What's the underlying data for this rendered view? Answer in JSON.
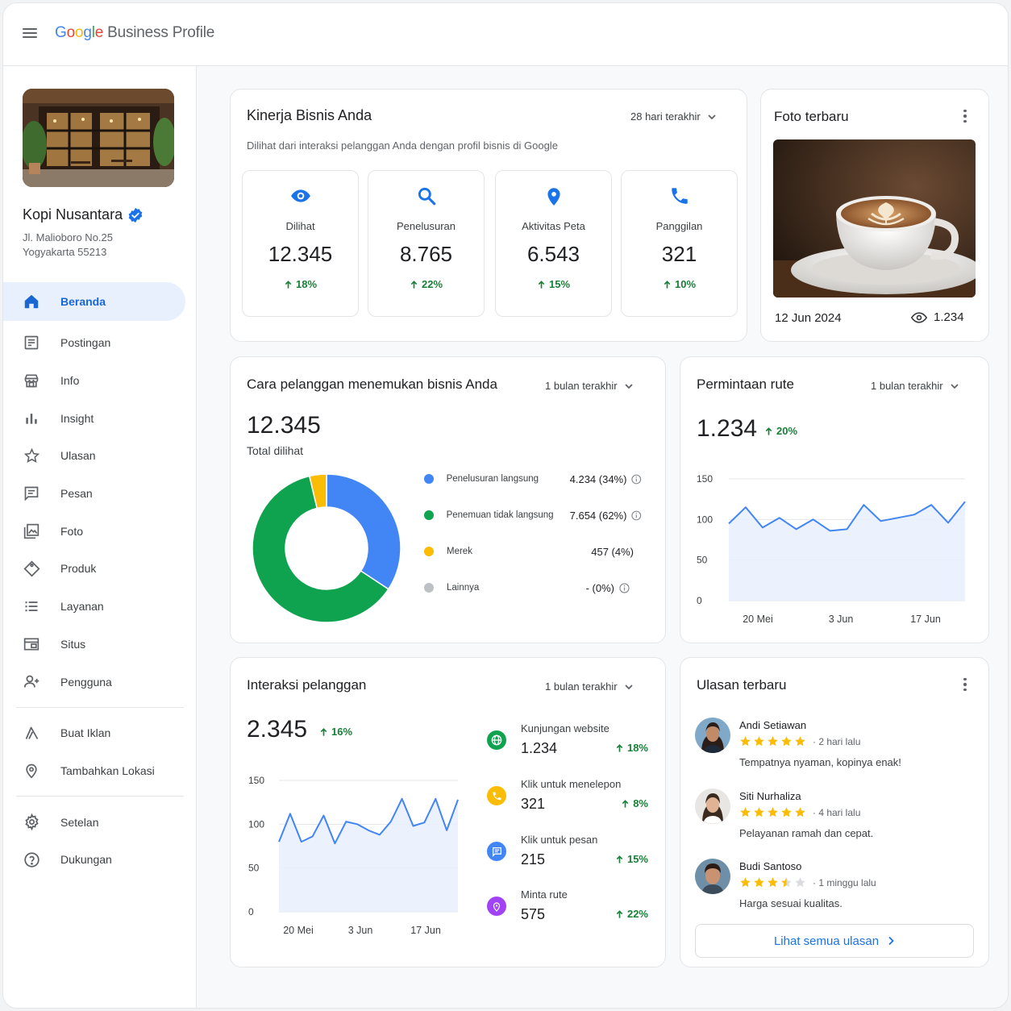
{
  "app": {
    "logo_parts": [
      "G",
      "o",
      "o",
      "g",
      "l",
      "e"
    ],
    "product": "Business Profile"
  },
  "business": {
    "name": "Kopi Nusantara",
    "address_line1": "Jl. Malioboro No.25",
    "address_line2": "Yogyakarta 55213"
  },
  "nav": {
    "items": [
      {
        "label": "Beranda",
        "icon": "home-icon"
      },
      {
        "label": "Postingan",
        "icon": "posts-icon"
      },
      {
        "label": "Info",
        "icon": "store-icon"
      },
      {
        "label": "Insight",
        "icon": "bar-chart-icon"
      },
      {
        "label": "Ulasan",
        "icon": "star-icon"
      },
      {
        "label": "Pesan",
        "icon": "message-icon"
      },
      {
        "label": "Foto",
        "icon": "photo-icon"
      },
      {
        "label": "Produk",
        "icon": "tag-icon"
      },
      {
        "label": "Layanan",
        "icon": "list-icon"
      },
      {
        "label": "Situs",
        "icon": "website-icon"
      },
      {
        "label": "Pengguna",
        "icon": "add-user-icon"
      }
    ],
    "extra": [
      {
        "label": "Buat Iklan",
        "icon": "ads-icon"
      },
      {
        "label": "Tambahkan Lokasi",
        "icon": "location-icon"
      }
    ],
    "bottom": [
      {
        "label": "Setelan",
        "icon": "gear-icon"
      },
      {
        "label": "Dukungan",
        "icon": "help-icon"
      }
    ]
  },
  "performance": {
    "title": "Kinerja Bisnis Anda",
    "range": "28 hari terakhir",
    "subtitle": "Dilihat dari interaksi pelanggan Anda dengan profil bisnis di Google",
    "metrics": [
      {
        "label": "Dilihat",
        "value": "12.345",
        "delta": "18%",
        "icon": "eye-icon"
      },
      {
        "label": "Penelusuran",
        "value": "8.765",
        "delta": "22%",
        "icon": "search-icon"
      },
      {
        "label": "Aktivitas Peta",
        "value": "6.543",
        "delta": "15%",
        "icon": "map-pin-icon"
      },
      {
        "label": "Panggilan",
        "value": "321",
        "delta": "10%",
        "icon": "phone-icon"
      }
    ]
  },
  "photo": {
    "title": "Foto terbaru",
    "date": "12 Jun 2024",
    "views": "1.234"
  },
  "discovery": {
    "title": "Cara pelanggan menemukan bisnis Anda",
    "range": "1 bulan terakhir",
    "total": "12.345",
    "total_label": "Total dilihat",
    "legend": [
      {
        "name": "Penelusuran langsung",
        "value": "4.234 (34%)",
        "color": "#4285f4",
        "info": true
      },
      {
        "name": "Penemuan tidak langsung",
        "value": "7.654 (62%)",
        "color": "#0fa34f",
        "info": true
      },
      {
        "name": "Merek",
        "value": "457 (4%)",
        "color": "#fbbc05",
        "info": false
      },
      {
        "name": "Lainnya",
        "value": "- (0%)",
        "color": "#bdc1c6",
        "info": true
      }
    ]
  },
  "routes": {
    "title": "Permintaan rute",
    "range": "1 bulan terakhir",
    "value": "1.234",
    "delta": "20%"
  },
  "interactions": {
    "title": "Interaksi pelanggan",
    "range": "1 bulan terakhir",
    "value": "2.345",
    "delta": "16%",
    "rows": [
      {
        "label": "Kunjungan website",
        "value": "1.234",
        "delta": "18%",
        "icon": "globe-icon",
        "color": "#0fa34f"
      },
      {
        "label": "Klik untuk menelepon",
        "value": "321",
        "delta": "8%",
        "icon": "phone-icon",
        "color": "#fbbc05"
      },
      {
        "label": "Klik untuk pesan",
        "value": "215",
        "delta": "15%",
        "icon": "chat-icon",
        "color": "#4285f4"
      },
      {
        "label": "Minta rute",
        "value": "575",
        "delta": "22%",
        "icon": "map-pin-icon",
        "color": "#a142f4"
      }
    ]
  },
  "reviews": {
    "title": "Ulasan terbaru",
    "items": [
      {
        "name": "Andi Setiawan",
        "rating": 5,
        "time": "· 2 hari lalu",
        "text": "Tempatnya nyaman, kopinya enak!"
      },
      {
        "name": "Siti Nurhaliza",
        "rating": 5,
        "time": "· 4 hari lalu",
        "text": "Pelayanan ramah dan cepat."
      },
      {
        "name": "Budi Santoso",
        "rating": 3.5,
        "time": "· 1 minggu lalu",
        "text": "Harga sesuai kualitas."
      }
    ],
    "see_all": "Lihat semua ulasan"
  },
  "chart_data": [
    {
      "type": "pie",
      "title": "Cara pelanggan menemukan bisnis Anda",
      "categories": [
        "Penelusuran langsung",
        "Penemuan tidak langsung",
        "Merek",
        "Lainnya"
      ],
      "values": [
        4234,
        7654,
        457,
        0
      ],
      "colors": [
        "#4285f4",
        "#0fa34f",
        "#fbbc05",
        "#bdc1c6"
      ]
    },
    {
      "type": "area",
      "title": "Permintaan rute",
      "ylim": [
        0,
        150
      ],
      "yticks": [
        0,
        50,
        100,
        150
      ],
      "xticks": [
        "20 Mei",
        "3 Jun",
        "17 Jun"
      ],
      "values": [
        95,
        115,
        90,
        102,
        88,
        100,
        86,
        88,
        118,
        98,
        102,
        106,
        118,
        96,
        122
      ],
      "grid": true
    },
    {
      "type": "area",
      "title": "Interaksi pelanggan",
      "ylim": [
        0,
        150
      ],
      "yticks": [
        0,
        50,
        100,
        150
      ],
      "xticks": [
        "20 Mei",
        "3 Jun",
        "17 Jun"
      ],
      "values": [
        80,
        112,
        80,
        86,
        110,
        78,
        103,
        100,
        93,
        88,
        103,
        129,
        98,
        102,
        129,
        93,
        128
      ],
      "grid": true
    }
  ]
}
